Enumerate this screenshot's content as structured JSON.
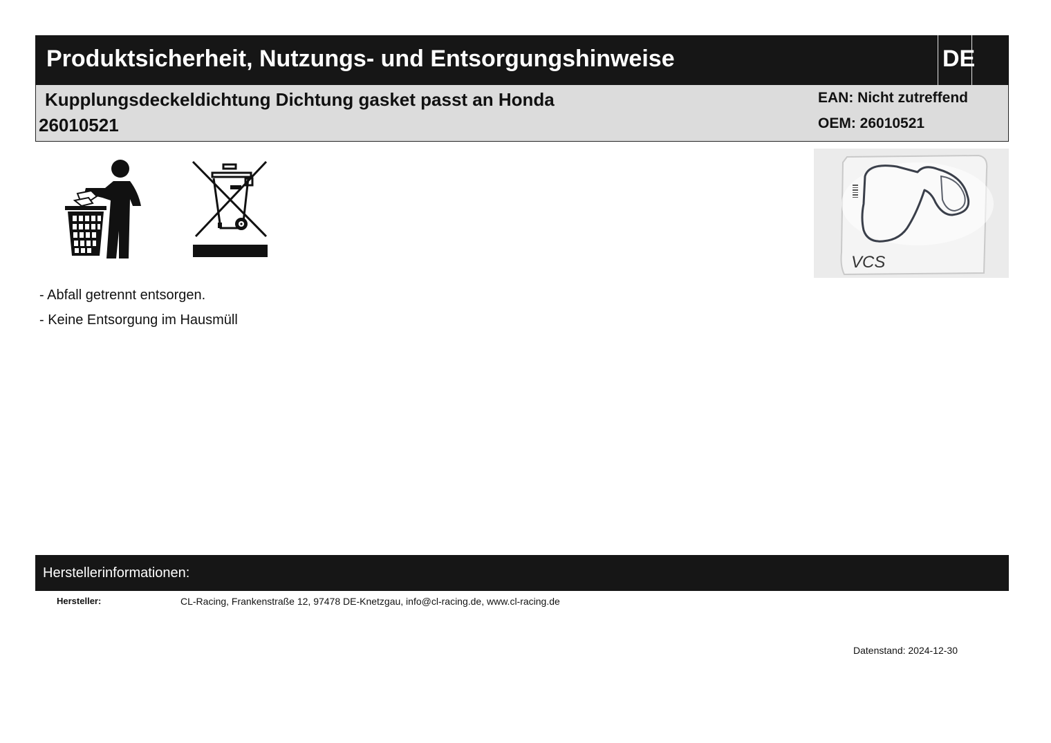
{
  "header": {
    "title": "Produktsicherheit, Nutzungs- und Entsorgungshinweise",
    "language": "DE"
  },
  "product": {
    "name": "Kupplungsdeckeldichtung Dichtung gasket passt an Honda",
    "number": "26010521",
    "ean": "EAN: Nicht zutreffend",
    "oem": "OEM: 26010521"
  },
  "icons": {
    "disposal": "tidyman-disposal-icon",
    "weee": "crossed-out-wheelie-bin-icon"
  },
  "photo": {
    "handwriting": "VCS"
  },
  "notes": [
    "- Abfall getrennt entsorgen.",
    "- Keine Entsorgung im Hausmüll"
  ],
  "manufacturer": {
    "section_title": "Herstellerinformationen:",
    "label": "Hersteller:",
    "value": "CL-Racing, Frankenstraße 12, 97478 DE-Knetzgau, info@cl-racing.de, www.cl-racing.de"
  },
  "footer": {
    "date": "Datenstand: 2024-12-30"
  }
}
